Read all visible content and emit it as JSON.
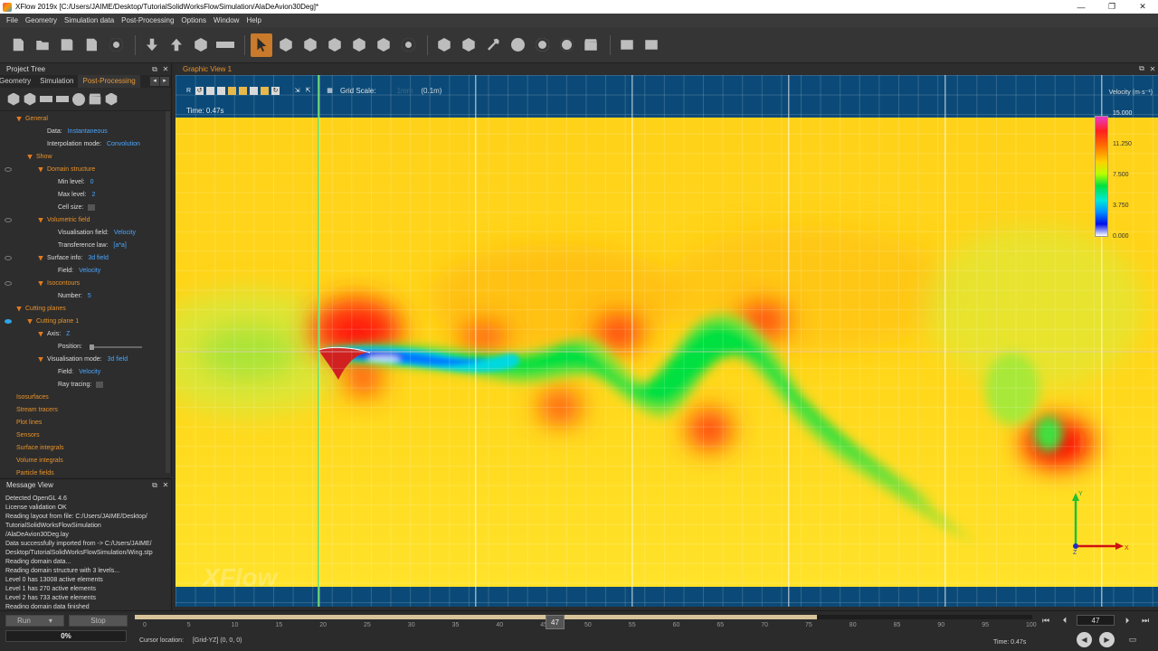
{
  "window": {
    "title": "XFlow 2019x [C:/Users/JAIME/Desktop/TutorialSolidWorksFlowSimulation/AlaDeAvion30Deg]*",
    "controls": [
      "—",
      "❐",
      "✕"
    ]
  },
  "menu": [
    "File",
    "Geometry",
    "Simulation data",
    "Post-Processing",
    "Options",
    "Window",
    "Help"
  ],
  "toolbar": {
    "icons": [
      "new-document-icon",
      "open-folder-icon",
      "save-icon",
      "save-as-icon",
      "settings-gear-icon",
      "import-icon",
      "export-icon",
      "cube-icon",
      "ruler-icon",
      "select-cursor-icon",
      "select-object-icon",
      "select-face-icon",
      "select-edge-icon",
      "select-vertex-icon",
      "select-part-icon",
      "select-all-icon",
      "transform-icon",
      "transform-copy-icon",
      "wrench-icon",
      "zoom-fit-icon",
      "target-icon",
      "target-center-icon",
      "clapperboard-icon",
      "screenshot-icon",
      "window-icon"
    ],
    "active_index": 9
  },
  "project_tree": {
    "title": "Project Tree",
    "tabs": [
      "Geometry",
      "Simulation",
      "Post-Processing"
    ],
    "active_tab": 2,
    "items": [
      {
        "label": "General",
        "level": 1,
        "expanded": true,
        "orange": true
      },
      {
        "label": "Data:",
        "level": 3,
        "value": "Instantaneous"
      },
      {
        "label": "Interpolation mode:",
        "level": 3,
        "value": "Convolution"
      },
      {
        "label": "Show",
        "level": 2,
        "expanded": true,
        "orange": true
      },
      {
        "label": "Domain structure",
        "level": 3,
        "expanded": true,
        "orange": true,
        "eye": "off"
      },
      {
        "label": "Min level:",
        "level": 4,
        "value": "0"
      },
      {
        "label": "Max level:",
        "level": 4,
        "value": "2"
      },
      {
        "label": "Cell size:",
        "level": 4,
        "checkbox": true
      },
      {
        "label": "Volumetric field",
        "level": 3,
        "expanded": true,
        "orange": true,
        "eye": "off"
      },
      {
        "label": "Visualisation field:",
        "level": 4,
        "value": "Velocity"
      },
      {
        "label": "Transference law:",
        "level": 4,
        "value": "[a*a]"
      },
      {
        "label": "Surface info:",
        "level": 3,
        "expanded": true,
        "value": "3d field",
        "eye": "off"
      },
      {
        "label": "Field:",
        "level": 4,
        "value": "Velocity"
      },
      {
        "label": "Isocontours",
        "level": 3,
        "expanded": true,
        "orange": true,
        "eye": "off"
      },
      {
        "label": "Number:",
        "level": 4,
        "value": "5"
      },
      {
        "label": "Cutting planes",
        "level": 1,
        "expanded": true,
        "orange": true
      },
      {
        "label": "Cutting plane 1",
        "level": 2,
        "expanded": true,
        "orange": true,
        "eye": "on"
      },
      {
        "label": "Axis:",
        "level": 3,
        "expanded": true,
        "value": "Z"
      },
      {
        "label": "Position:",
        "level": 4,
        "slider": true
      },
      {
        "label": "Visualisation mode:",
        "level": 3,
        "expanded": true,
        "value": "3d field"
      },
      {
        "label": "Field:",
        "level": 4,
        "value": "Velocity"
      },
      {
        "label": "Ray tracing:",
        "level": 4,
        "checkbox": true
      },
      {
        "label": "Isosurfaces",
        "level": 1,
        "orange": true
      },
      {
        "label": "Stream tracers",
        "level": 1,
        "orange": true
      },
      {
        "label": "Plot lines",
        "level": 1,
        "orange": true
      },
      {
        "label": "Sensors",
        "level": 1,
        "orange": true
      },
      {
        "label": "Surface integrals",
        "level": 1,
        "orange": true
      },
      {
        "label": "Volume integrals",
        "level": 1,
        "orange": true
      },
      {
        "label": "Particle fields",
        "level": 1,
        "orange": true
      }
    ]
  },
  "message_view": {
    "title": "Message View",
    "lines": [
      "Detected OpenGL 4.6",
      "License validation OK",
      "Reading layout from file: C:/Users/JAIME/Desktop/",
      "TutorialSolidWorksFlowSimulation",
      "/AlaDeAvion30Deg.lay",
      "Data successfully imported from -> C:/Users/JAIME/",
      "Desktop/TutorialSolidWorksFlowSimulation/Wing.stp",
      "Reading domain data...",
      "Reading domain structure with 3 levels...",
      "  Level 0 has 13008 active elements",
      "  Level 1 has 270 active elements",
      "  Level 2 has 733 active elements",
      "Reading domain data finished"
    ]
  },
  "graphic_view": {
    "title": "Graphic View 1",
    "toolbar_icons": [
      "R",
      "↺",
      "▢",
      "▢",
      "▢",
      "▢",
      "▢",
      "▢",
      "↻",
      "⇲",
      "⇱",
      "▦"
    ],
    "grid_scale_label": "Grid Scale:",
    "grid_scale_value": "1mm",
    "grid_scale_value2": "(0.1m)",
    "time": "Time: 0.47s",
    "legend_title": "Velocity (m·s⁻¹)",
    "legend_values": [
      "15.000",
      "11.250",
      "7.500",
      "3.750",
      "0.000"
    ],
    "watermark": "XFlow",
    "axes": {
      "y": "Y",
      "x": "X",
      "z": "Z"
    }
  },
  "bottom": {
    "run_label": "Run",
    "stop_label": "Stop",
    "progress_text": "0%",
    "ticks": [
      "0",
      "5",
      "10",
      "15",
      "20",
      "25",
      "30",
      "35",
      "40",
      "45",
      "50",
      "55",
      "60",
      "65",
      "70",
      "75",
      "80",
      "85",
      "90",
      "95",
      "100"
    ],
    "current_frame": "47",
    "timeline_progress": 0.76,
    "cursor_label": "Cursor location:",
    "cursor_value": "[Grid-YZ] (0, 0, 0)",
    "time_text": "Time: 0.47s",
    "frame_input": "47"
  }
}
